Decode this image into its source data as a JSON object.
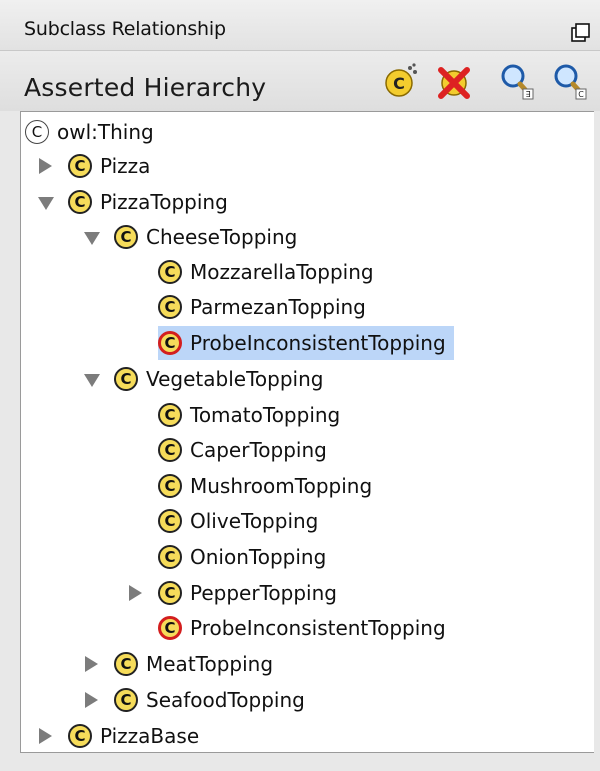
{
  "panel": {
    "tab_title": "Subclass Relationship",
    "title": "Asserted Hierarchy"
  },
  "toolbar": {
    "icons": [
      "create-subclass-icon",
      "delete-class-icon",
      "find-class-icon",
      "find-class-c-icon"
    ]
  },
  "colors": {
    "class_badge": "#f6dc5a",
    "inconsistent_ring": "#d31e1e",
    "selection": "#bcd6f8"
  },
  "tree": {
    "root": {
      "badge": "C",
      "label": "owl:Thing"
    },
    "pizza": {
      "badge": "C",
      "label": "Pizza"
    },
    "pizza_topping": {
      "badge": "C",
      "label": "PizzaTopping"
    },
    "cheese_topping": {
      "badge": "C",
      "label": "CheeseTopping"
    },
    "mozzarella": {
      "badge": "C",
      "label": "MozzarellaTopping"
    },
    "parmezan": {
      "badge": "C",
      "label": "ParmezanTopping"
    },
    "probe_cheese": {
      "badge": "C",
      "label": "ProbeInconsistentTopping"
    },
    "vegetable_topping": {
      "badge": "C",
      "label": "VegetableTopping"
    },
    "tomato": {
      "badge": "C",
      "label": "TomatoTopping"
    },
    "caper": {
      "badge": "C",
      "label": "CaperTopping"
    },
    "mushroom": {
      "badge": "C",
      "label": "MushroomTopping"
    },
    "olive": {
      "badge": "C",
      "label": "OliveTopping"
    },
    "onion": {
      "badge": "C",
      "label": "OnionTopping"
    },
    "pepper": {
      "badge": "C",
      "label": "PepperTopping"
    },
    "probe_vegetable": {
      "badge": "C",
      "label": "ProbeInconsistentTopping"
    },
    "meat_topping": {
      "badge": "C",
      "label": "MeatTopping"
    },
    "seafood_topping": {
      "badge": "C",
      "label": "SeafoodTopping"
    },
    "pizza_base": {
      "badge": "C",
      "label": "PizzaBase"
    }
  }
}
